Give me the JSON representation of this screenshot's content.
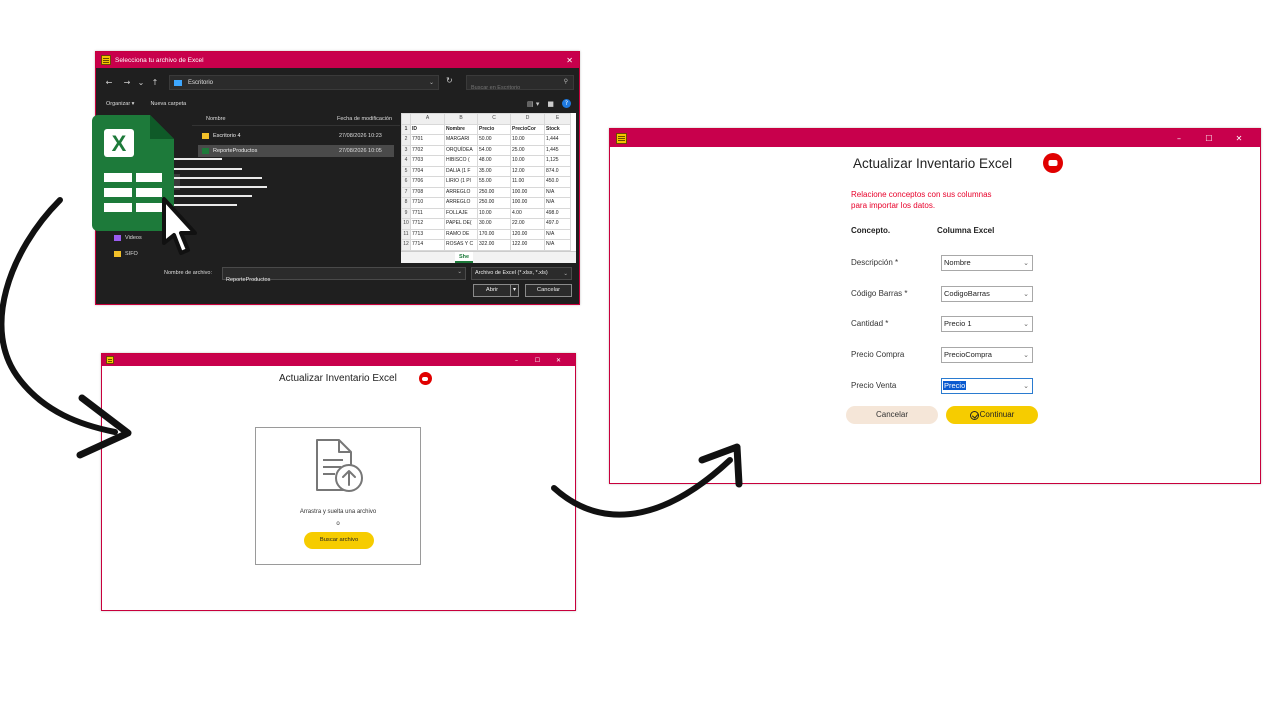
{
  "file_dialog": {
    "title": "Selecciona tu archivo de Excel",
    "close_glyph": "✕",
    "nav": {
      "back": "←",
      "forward": "→",
      "recent": "⌄",
      "up": "↑"
    },
    "address": "Escritorio",
    "search_placeholder": "Buscar en Escritorio",
    "toolbar": {
      "organize": "Organizar ▾",
      "new_folder": "Nueva carpeta"
    },
    "columns": {
      "name": "Nombre",
      "date": "Fecha de modificación"
    },
    "files": [
      {
        "name": "Escritorio 4",
        "date": "27/08/2026 10:23",
        "type": "folder"
      },
      {
        "name": "ReporteProductos",
        "date": "27/08/2026 10:05",
        "type": "excel",
        "selected": true
      }
    ],
    "sidebar": [
      {
        "label": "Videos",
        "type": "video"
      },
      {
        "label": "SIFO",
        "type": "folder"
      }
    ],
    "filename_label": "Nombre de archivo:",
    "filename_value": "ReporteProductos",
    "filetype": "Archivo de Excel (*.xlsx, *.xls)",
    "open_label": "Abrir",
    "cancel_label": "Cancelar"
  },
  "excel_preview": {
    "col_letters": [
      "A",
      "B",
      "C",
      "D",
      "E"
    ],
    "header_row": [
      "ID",
      "Nombre",
      "Precio",
      "PrecioCor",
      "Stock"
    ],
    "rows": [
      [
        "7701",
        "MARGARI",
        "50.00",
        "10.00",
        "1,444"
      ],
      [
        "7702",
        "ORQUÍDEA",
        "54.00",
        "25.00",
        "1,445"
      ],
      [
        "7703",
        "HIBISCO (",
        "48.00",
        "10.00",
        "1,125"
      ],
      [
        "7704",
        "DALIA (1 F",
        "35.00",
        "12.00",
        "874.0"
      ],
      [
        "7706",
        "LIRIO (1 Pl",
        "55.00",
        "11.00",
        "450.0"
      ],
      [
        "7708",
        "ARREGLO",
        "250.00",
        "100.00",
        "N/A"
      ],
      [
        "7710",
        "ARREGLO",
        "250.00",
        "100.00",
        "N/A"
      ],
      [
        "7711",
        "FOLLAJE",
        "10.00",
        "4.00",
        "498.0"
      ],
      [
        "7712",
        "PAPEL DE(",
        "30.00",
        "22.00",
        "497.0"
      ],
      [
        "7713",
        "RAMO DE",
        "170.00",
        "120.00",
        "N/A"
      ],
      [
        "7714",
        "ROSAS Y C",
        "322.00",
        "122.00",
        "N/A"
      ]
    ],
    "sheet_tab": "She"
  },
  "upload_window": {
    "title": "Actualizar Inventario Excel",
    "drop_text": "Arrastra y suelta una archivo",
    "or_text": "o",
    "browse_label": "Buscar archivo",
    "controls": {
      "min": "–",
      "max": "☐",
      "close": "✕"
    }
  },
  "map_window": {
    "title": "Actualizar Inventario Excel",
    "instruction_line1": "Relacione conceptos con sus columnas",
    "instruction_line2": "para importar los datos.",
    "col_concept": "Concepto.",
    "col_excel": "Columna Excel",
    "mappings": [
      {
        "label": "Descripción *",
        "value": "Nombre"
      },
      {
        "label": "Código Barras *",
        "value": "CodigoBarras"
      },
      {
        "label": "Cantidad *",
        "value": "Precio 1"
      },
      {
        "label": "Precio Compra",
        "value": "PrecioCompra"
      },
      {
        "label": "Precio Venta",
        "value": "Precio"
      }
    ],
    "cancel_label": "Cancelar",
    "continue_label": "Continuar",
    "controls": {
      "min": "–",
      "max": "☐",
      "close": "✕"
    }
  },
  "colors": {
    "title_bar": "#c8004c",
    "accent_yellow": "#f6cc00",
    "instruction_red": "#e8002a",
    "excel_green": "#1d7a3a",
    "youtube_red": "#e00000"
  }
}
